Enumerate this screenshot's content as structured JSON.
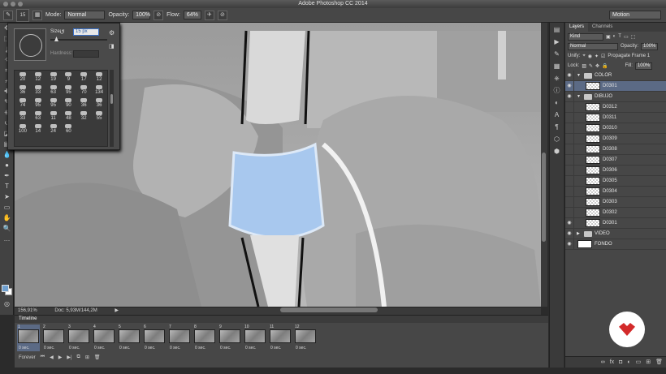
{
  "app": {
    "title": "Adobe Photoshop CC 2014"
  },
  "options_bar": {
    "brush_size": "15",
    "mode_label": "Mode:",
    "mode_value": "Normal",
    "opacity_label": "Opacity:",
    "opacity_value": "100%",
    "flow_label": "Flow:",
    "flow_value": "64%",
    "workspace": "Motion"
  },
  "brush_picker": {
    "size_label": "Size:",
    "size_value": "15 px",
    "hardness_label": "Hardness:",
    "presets": [
      "20",
      "12",
      "19",
      "9",
      "17",
      "12",
      "36",
      "33",
      "63",
      "95",
      "70",
      "134",
      "74",
      "95",
      "95",
      "90",
      "36",
      "36",
      "33",
      "63",
      "11",
      "48",
      "32",
      "55",
      "100",
      "14",
      "24",
      "60"
    ]
  },
  "status_bar": {
    "zoom": "156,91%",
    "doc": "Doc: 5,93M/144,2M"
  },
  "timeline": {
    "title": "Timeline",
    "frames": [
      {
        "num": "1",
        "time": "0 sec."
      },
      {
        "num": "2",
        "time": "0 sec."
      },
      {
        "num": "3",
        "time": "0 sec."
      },
      {
        "num": "4",
        "time": "0 sec."
      },
      {
        "num": "5",
        "time": "0 sec."
      },
      {
        "num": "6",
        "time": "0 sec."
      },
      {
        "num": "7",
        "time": "0 sec."
      },
      {
        "num": "8",
        "time": "0 sec."
      },
      {
        "num": "9",
        "time": "0 sec."
      },
      {
        "num": "10",
        "time": "0 sec."
      },
      {
        "num": "11",
        "time": "0 sec."
      },
      {
        "num": "12",
        "time": "0 sec."
      }
    ],
    "loop": "Forever"
  },
  "layers_panel": {
    "tabs": [
      "Layers",
      "Channels"
    ],
    "filter": "Kind",
    "blend_mode": "Normal",
    "opacity_label": "Opacity:",
    "opacity_value": "100%",
    "unify_label": "Unify:",
    "propagate_label": "Propagate Frame 1",
    "lock_label": "Lock:",
    "fill_label": "Fill:",
    "fill_value": "100%",
    "layers": [
      {
        "name": "COLOR",
        "type": "group",
        "visible": true
      },
      {
        "name": "D0301",
        "type": "layer",
        "visible": true,
        "selected": true
      },
      {
        "name": "DIBUJO",
        "type": "group",
        "visible": true
      },
      {
        "name": "D0312",
        "type": "layer",
        "visible": false
      },
      {
        "name": "D0311",
        "type": "layer",
        "visible": false
      },
      {
        "name": "D0310",
        "type": "layer",
        "visible": false
      },
      {
        "name": "D0309",
        "type": "layer",
        "visible": false
      },
      {
        "name": "D0308",
        "type": "layer",
        "visible": false
      },
      {
        "name": "D0307",
        "type": "layer",
        "visible": false
      },
      {
        "name": "D0306",
        "type": "layer",
        "visible": false
      },
      {
        "name": "D0305",
        "type": "layer",
        "visible": false
      },
      {
        "name": "D0304",
        "type": "layer",
        "visible": false
      },
      {
        "name": "D0303",
        "type": "layer",
        "visible": false
      },
      {
        "name": "D0302",
        "type": "layer",
        "visible": false
      },
      {
        "name": "D0301",
        "type": "layer",
        "visible": true
      },
      {
        "name": "VIDEO",
        "type": "group",
        "visible": true
      },
      {
        "name": "FONDO",
        "type": "layer-white",
        "visible": true
      }
    ]
  }
}
